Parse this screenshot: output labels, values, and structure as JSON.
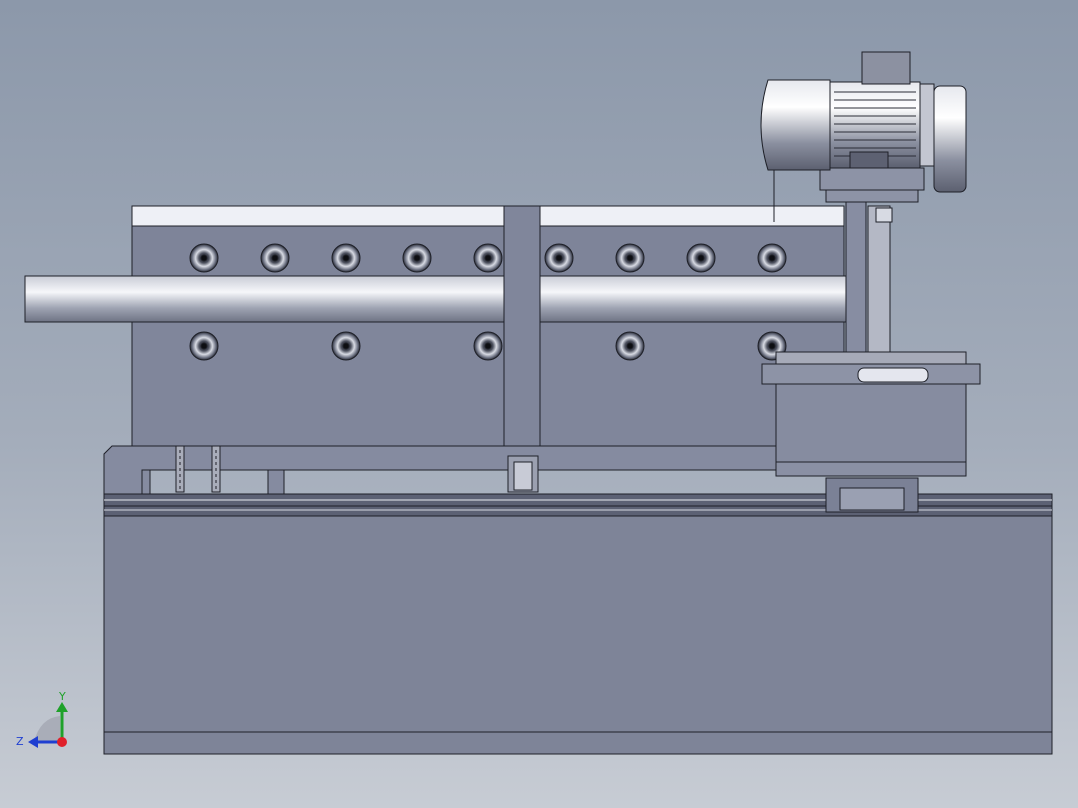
{
  "viewport": {
    "background_top": "#8c98aa",
    "background_bottom": "#c7ccd4"
  },
  "triad": {
    "y_label": "Y",
    "z_label": "Z",
    "y_color": "#1fa12a",
    "z_color": "#1f3fd1",
    "x_color": "#e0202a"
  },
  "model": {
    "body_color": "#7f8598",
    "edge_color": "#1e2028",
    "highlight_color": "#eef0f6",
    "motor_color": "#b5b9c6"
  }
}
